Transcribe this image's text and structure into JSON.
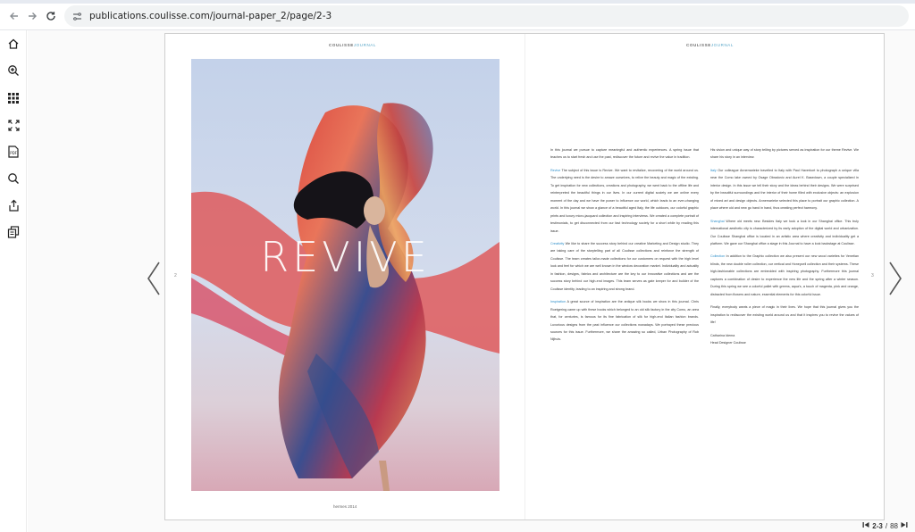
{
  "browser": {
    "url": "publications.coulisse.com/journal-paper_2/page/2-3"
  },
  "sidebar": {
    "items": [
      {
        "name": "home-icon"
      },
      {
        "name": "zoom-in-icon"
      },
      {
        "name": "grid-icon"
      },
      {
        "name": "fullscreen-icon"
      },
      {
        "name": "download-pdf-icon"
      },
      {
        "name": "search-icon"
      },
      {
        "name": "share-icon"
      },
      {
        "name": "pages-icon"
      }
    ]
  },
  "spread": {
    "masthead_left": "COULISSE",
    "masthead_left_j": "JOURNAL",
    "masthead_right": "COULISSE",
    "masthead_right_j": "JOURNAL",
    "photo_title": "REVIVE",
    "folio": "hermes 2014",
    "page_left_num": "2",
    "page_right_num": "3"
  },
  "article": {
    "col1": {
      "intro": "In this journal we pursue to capture meaningful and authentic experiences. A spring issue that teaches us to start fresh and use the past, rediscover the future and revive the value in tradition.",
      "p1_hl": "Revive",
      "p1": " The subject of this issue is Revive. We want to revitalize, recovering of the world around us. The underlying need is the desire to amaze ourselves, to relive the beauty and magic of the existing. To get inspiration for new collections, creations and photography, we went back to the offline life and reinterpreted the beautiful things in our lives. In our current digital society we are online every moment of the day and we have the power to influence our world, which leads to an ever-changing world. In this journal we show a glance of a beautiful aged Italy, the life outdoors, our colorful graphic prints and luxury micro-jacquard collection and inspiring interviews. We created a complete portrait of testimonials, to get disconnected from our fast technology society for a short while by reading this issue.",
      "p2_hl": "Creativity",
      "p2": " We like to share the success story behind our creative Marketing and Design studio. They are taking care of the storytelling part of all Coulisse collections and reinforce the strength of Coulisse. The team creates tailor-made collections for our customers on request with the high level look and feel for which we are well known in the window decoration market. Individuality and actuality in fashion, designs, fabrics and architecture are the key to our innovative collections and are the success story behind our high-end images. This team serves as gate keeper for and builder of the Coulisse identity, leading to an inspiring and strong brand.",
      "p3_hl": "Inspiration",
      "p3": " A great source of inspiration are the antique silk books we show in this journal. Chris Roetgering came up with these books which belonged to an old silk factory in the city Como, an area that, for centuries, is famous for its fine fabrication of silk for high-end Italian fashion brands. Luxurious designs from the past influence our collections nowadays. We portrayed these precious sources for this issue. Furthermore, we share the amazing so called, Urban Photography of Rob Nijhuis."
    },
    "col2": {
      "intro": "His vision and unique way of story telling by pictures served as inspiration for our theme Revive. We share his story in an interview.",
      "p1_hl": "Italy",
      "p1": " Our colleague Annemarieke travelled to Italy with Paul Haverkort to photograph a unique villa near the Como lake owned by Osage Obradovic and Aurel K. Basedown, a couple specialized in interior design. In this issue we tell their story and the ideas behind their designs. We were surprised by the beautiful surroundings and the interior of their home filled with exclusive objects: an explosion of mixed art and design objects. Annemarieke selected this place to portrait our graphic collection. A place where old and new go hand in hand, thus creating perfect harmony.",
      "p2_hl": "Shanghai",
      "p2": " Where old meets new. Besides Italy we took a look in our Shanghai office. This truly international aesthetic city is characterized by its early adoption of the digital world and urbanization. Our Coulisse Shanghai office is located in an artistic area where creativity and individuality get a platform. We gave our Shanghai office a stage in this Journal to have a look backstage at Coulisse.",
      "p3_hl": "Collection",
      "p3": " In addition to the Graphic collection we also present our new wood varieties for Venetian blinds, the new double roller collection, our vertical and Honeycell collection and their systems. These high-fashionable collections are embedded with inspiring photography. Furthermore this journal captures a combination of desire to experience the new life and the spring after a winter season. During this spring we see a colorful pallet with greens, aqua's, a touch of magenta, pink and orange, distracted from flowers and nature, essential elements for this colorful issue.",
      "closing": "Finally, everybody wants a piece of magic in their lives. We hope that this journal gives you the inspiration to rediscover the existing world around us and that it inspires you to revive the values of life!",
      "sign_name": "Catharina Idema",
      "sign_title": "Head Designer Coulisse"
    }
  },
  "footer": {
    "current": "2-3",
    "separator": " / ",
    "total": "88"
  },
  "colors": {
    "accent": "#2d8ec9",
    "nav_arrow": "#555555"
  }
}
